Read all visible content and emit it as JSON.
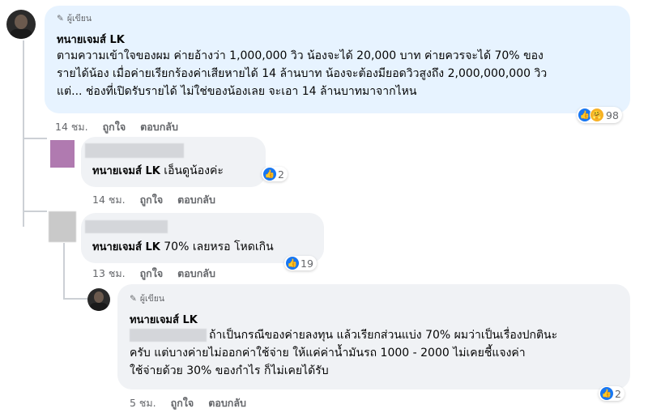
{
  "thread": {
    "c1": {
      "author_tag": "ผู้เขียน",
      "name": "ทนายเจมส์ LK",
      "text_lines": [
        "ตามความเข้าใจของผม ค่ายอ้างว่า 1,000,000 วิว น้องจะได้ 20,000 บาท ค่ายควรจะได้ 70% ของ",
        "รายได้น้อง เมื่อค่ายเรียกร้องค่าเสียหายได้ 14 ล้านบาท น้องจะต้องมียอดวิวสูงถึง 2,000,000,000 วิว",
        "แต่... ช่องที่เปิดรับรายได้ ไม่ใช่ของน้องเลย จะเอา 14 ล้านบาทมาจากไหน"
      ],
      "time": "14 ชม.",
      "like": "ถูกใจ",
      "reply": "ตอบกลับ",
      "reactions": "98"
    },
    "c2": {
      "mention": "ทนายเจมส์ LK",
      "text": " เอ็นดูน้องค่ะ",
      "time": "14 ชม.",
      "like": "ถูกใจ",
      "reply": "ตอบกลับ",
      "reactions": "2"
    },
    "c3": {
      "mention": "ทนายเจมส์ LK",
      "text": " 70% เลยหรอ โหดเกิน",
      "time": "13 ชม.",
      "like": "ถูกใจ",
      "reply": "ตอบกลับ",
      "reactions": "19"
    },
    "c4": {
      "author_tag": "ผู้เขียน",
      "name": "ทนายเจมส์ LK",
      "text_lines": [
        "ถ้าเป็นกรณีของค่ายลงทุน แล้วเรียกส่วนแบ่ง 70% ผมว่าเป็นเรื่องปกตินะ",
        "ครับ แต่บางค่ายไม่ออกค่าใช้จ่าย ให้แค่ค่าน้ำมันรถ 1000 - 2000 ไม่เคยชี้แจงค่า",
        "ใช้จ่ายด้วย 30% ของกำไร ก็ไม่เคยได้รับ"
      ],
      "time": "5 ชม.",
      "like": "ถูกใจ",
      "reply": "ตอบกลับ",
      "reactions": "2"
    }
  },
  "colors": {
    "like_blue": "#1877f2",
    "bubble": "#f0f2f5",
    "author_bubble": "#e7f3ff",
    "meta": "#65676b"
  }
}
